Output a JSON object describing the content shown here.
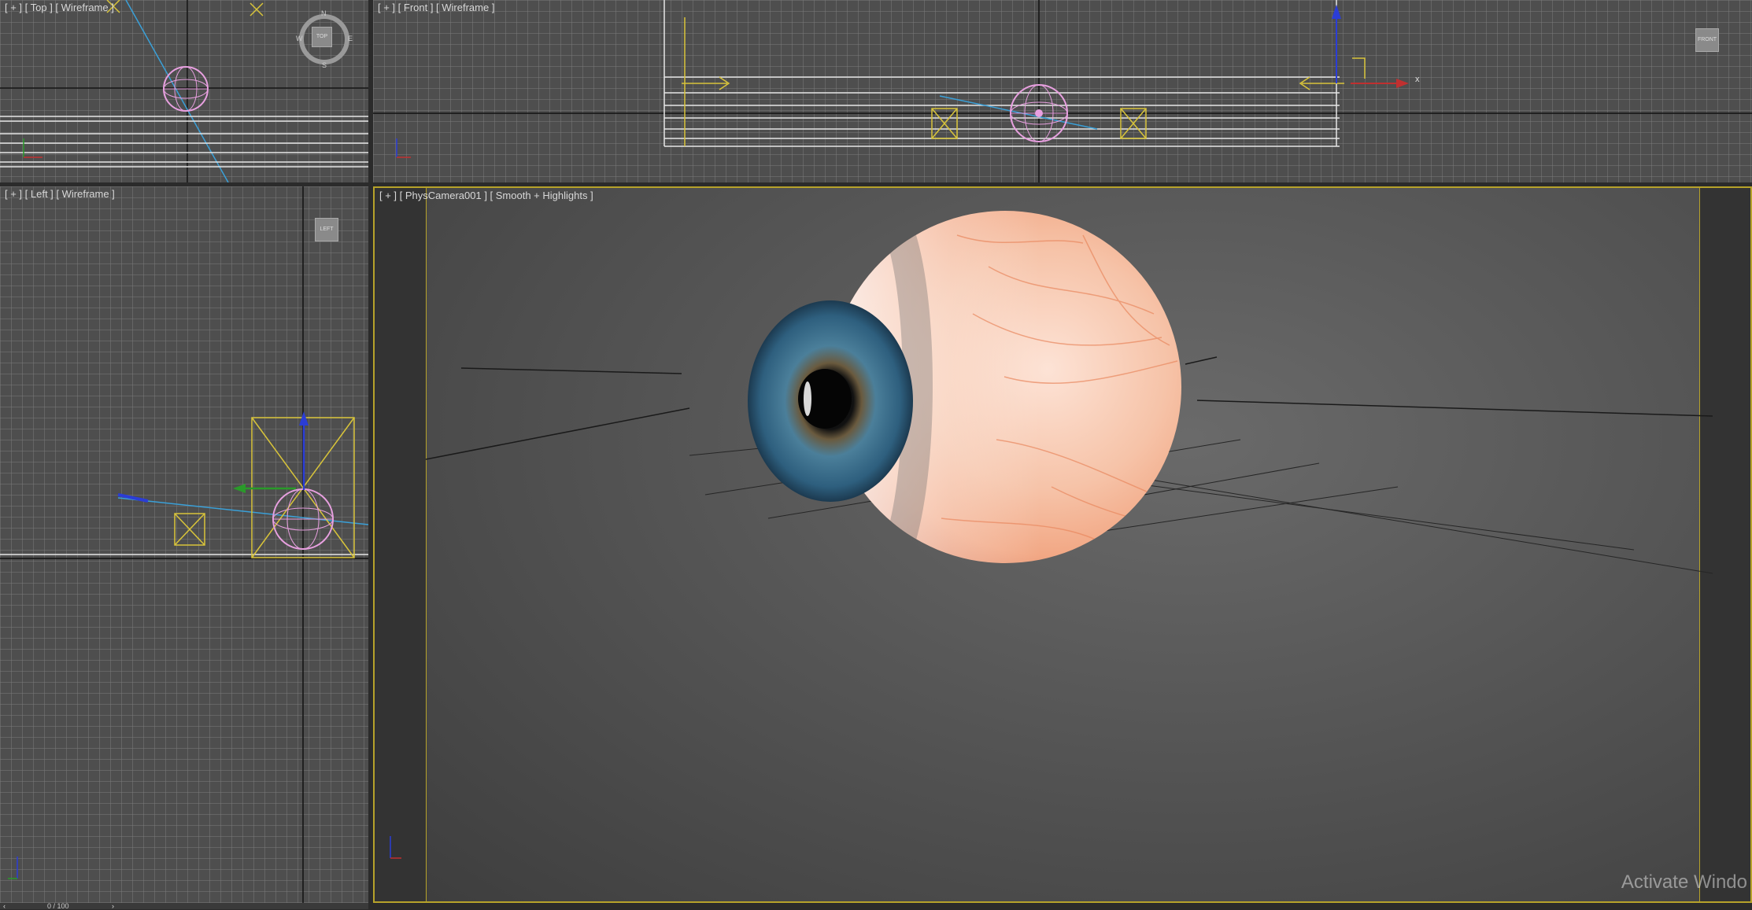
{
  "viewports": {
    "top": {
      "label": "[ + ] [ Top ] [ Wireframe ]",
      "viewcube": "TOP",
      "compass": {
        "n": "N",
        "s": "S",
        "e": "E",
        "w": "W"
      }
    },
    "front": {
      "label": "[ + ] [ Front ] [ Wireframe ]",
      "viewcube": "FRONT",
      "axis_x": "x"
    },
    "left": {
      "label": "[ + ] [ Left ] [ Wireframe ]",
      "viewcube": "LEFT"
    },
    "camera": {
      "label": "[ + ] [ PhysCamera001 ] [ Smooth + Highlights ]"
    }
  },
  "timeline": {
    "frame": "0 / 100"
  },
  "watermark": "Activate Windo",
  "colors": {
    "viewport_bg": "#4e4e4e",
    "selection_yellow": "#b6a22a",
    "sphere_wire": "#e8a0e0",
    "iris_blue": "#2e5f7e",
    "sclera": "#f3e4dc",
    "vein": "#e9885f"
  }
}
